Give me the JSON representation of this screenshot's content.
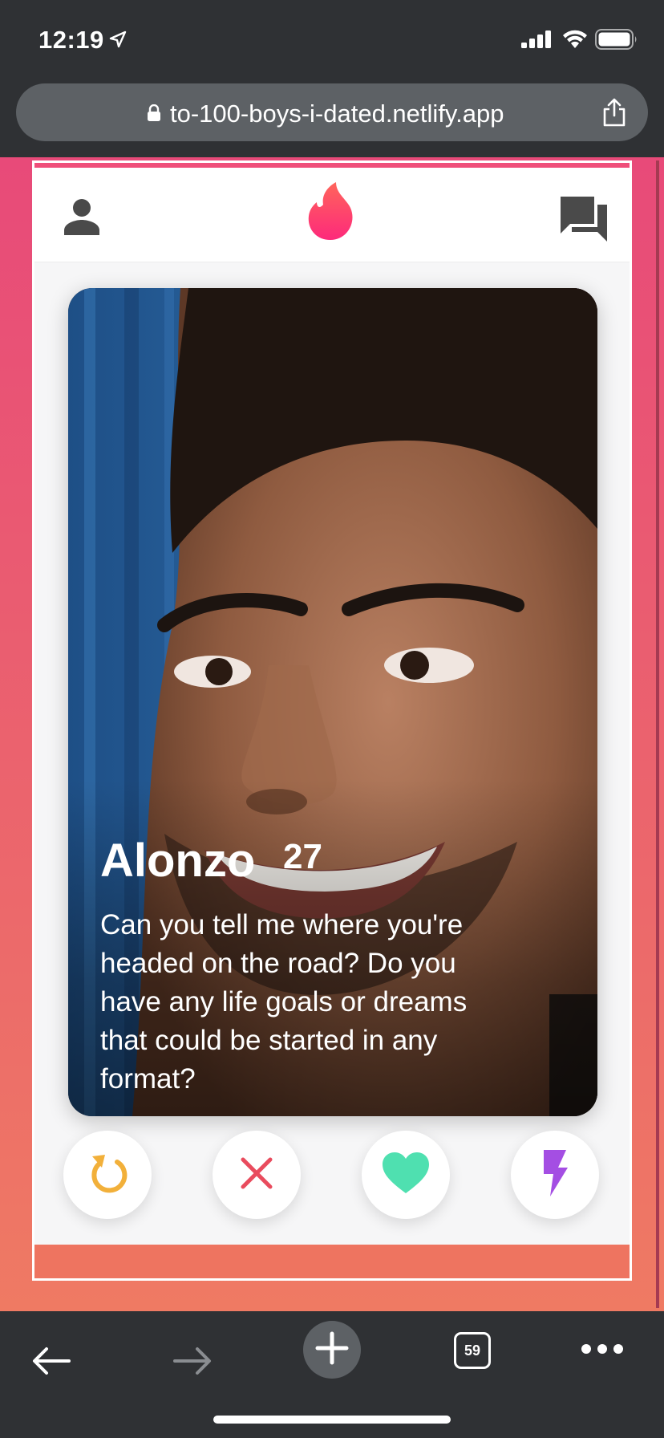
{
  "status_bar": {
    "time": "12:19",
    "icons": [
      "location-arrow-icon",
      "signal-icon",
      "wifi-icon",
      "battery-icon"
    ]
  },
  "browser": {
    "url": "to-100-boys-i-dated.netlify.app",
    "tab_count": "59",
    "icons": [
      "lock-icon",
      "share-icon",
      "back-arrow-icon",
      "forward-arrow-icon",
      "new-tab-plus-icon",
      "more-icon"
    ]
  },
  "app": {
    "header_icons": [
      "profile-icon",
      "flame-logo-icon",
      "chat-icon"
    ],
    "profile": {
      "name": "Alonzo",
      "age": "27",
      "bio": "Can you tell me where you're headed on the road? Do you have any life goals or dreams that could be started in any format?"
    },
    "actions": [
      {
        "name": "rewind",
        "icon": "rewind-icon",
        "color": "#f2b03a"
      },
      {
        "name": "nope",
        "icon": "close-icon",
        "color": "#e94b5d"
      },
      {
        "name": "like",
        "icon": "heart-icon",
        "color": "#4fe0b0"
      },
      {
        "name": "boost",
        "icon": "lightning-icon",
        "color": "#a44ee3"
      }
    ],
    "colors": {
      "brand_gradient_top": "#e84a79",
      "brand_gradient_bottom": "#ef7a63"
    }
  }
}
